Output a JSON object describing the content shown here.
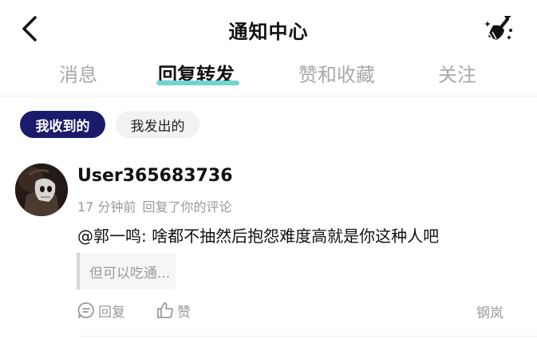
{
  "header": {
    "title": "通知中心",
    "back_icon": "chevron-left-icon",
    "clean_icon": "broom-sparkle-icon"
  },
  "tabs": [
    {
      "label": "消息",
      "active": false
    },
    {
      "label": "回复转发",
      "active": true
    },
    {
      "label": "赞和收藏",
      "active": false
    },
    {
      "label": "关注",
      "active": false
    }
  ],
  "filters": [
    {
      "label": "我收到的",
      "active": true
    },
    {
      "label": "我发出的",
      "active": false
    }
  ],
  "notification": {
    "username": "User365683736",
    "time": "17 分钟前",
    "action": "回复了你的评论",
    "reply": "@郭一鸣: 啥都不抽然后抱怨难度高就是你这种人吧",
    "quoted": "但可以吃通...",
    "reply_label": "回复",
    "like_label": "赞",
    "source": "钢岚"
  },
  "colors": {
    "accent_underline": "#6fd6cf",
    "active_filter_bg": "#1b1b6b",
    "muted_text": "#999999"
  }
}
